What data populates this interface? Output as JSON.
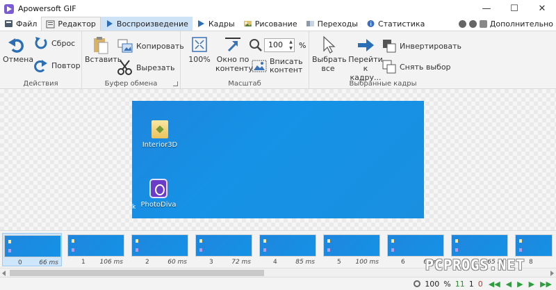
{
  "window": {
    "title": "Apowersoft GIF",
    "minimize": "—",
    "maximize": "☐",
    "close": "✕"
  },
  "tabs": [
    {
      "label": "Файл",
      "icon": "file-icon"
    },
    {
      "label": "Редактор",
      "icon": "editor-icon",
      "active": true
    },
    {
      "label": "Воспроизведение",
      "icon": "play-icon",
      "highlight": true
    },
    {
      "label": "Кадры",
      "icon": "frames-icon"
    },
    {
      "label": "Рисование",
      "icon": "drawing-icon"
    },
    {
      "label": "Переходы",
      "icon": "transitions-icon"
    },
    {
      "label": "Статистика",
      "icon": "statistics-icon"
    }
  ],
  "more_label": "Дополнительно",
  "ribbon": {
    "actions": {
      "undo": "Отмена",
      "reset": "Сброс",
      "redo": "Повтор",
      "label": "Действия"
    },
    "clipboard": {
      "paste": "Вставить",
      "copy": "Копировать",
      "cut": "Вырезать",
      "label": "Буфер обмена"
    },
    "scale": {
      "p100": "100%",
      "window_fit": "Окно по контенту",
      "fit_content": "Вписать контент",
      "zoom_value": "100",
      "zoom_unit": "%",
      "label": "Масштаб"
    },
    "selected": {
      "select_all": "Выбрать все",
      "goto": "Перейти к кадру...",
      "invert": "Инвертировать",
      "deselect": "Снять выбор",
      "label": "Выбранные кадры"
    }
  },
  "canvas": {
    "icons": [
      {
        "label": "Interior3D"
      },
      {
        "label": "PhotoDiva"
      }
    ],
    "cursor": "k"
  },
  "frames": [
    {
      "index": "0",
      "ms": "66 ms"
    },
    {
      "index": "1",
      "ms": "106 ms"
    },
    {
      "index": "2",
      "ms": "60 ms"
    },
    {
      "index": "3",
      "ms": "72 ms"
    },
    {
      "index": "4",
      "ms": "85 ms"
    },
    {
      "index": "5",
      "ms": "100 ms"
    },
    {
      "index": "6",
      "ms": "65 ms"
    },
    {
      "index": "7",
      "ms": "65 ms"
    },
    {
      "index": "8",
      "ms": ""
    }
  ],
  "status": {
    "zoom": "100",
    "zoom_unit": "%",
    "frame_count": "11",
    "selected_count": "1",
    "errors": "0"
  },
  "watermark": "PCPROGS.NET",
  "colors": {
    "accent": "#1592e6",
    "tab_highlight": "#cfe3f7",
    "nav_green": "#2e9e3e"
  }
}
